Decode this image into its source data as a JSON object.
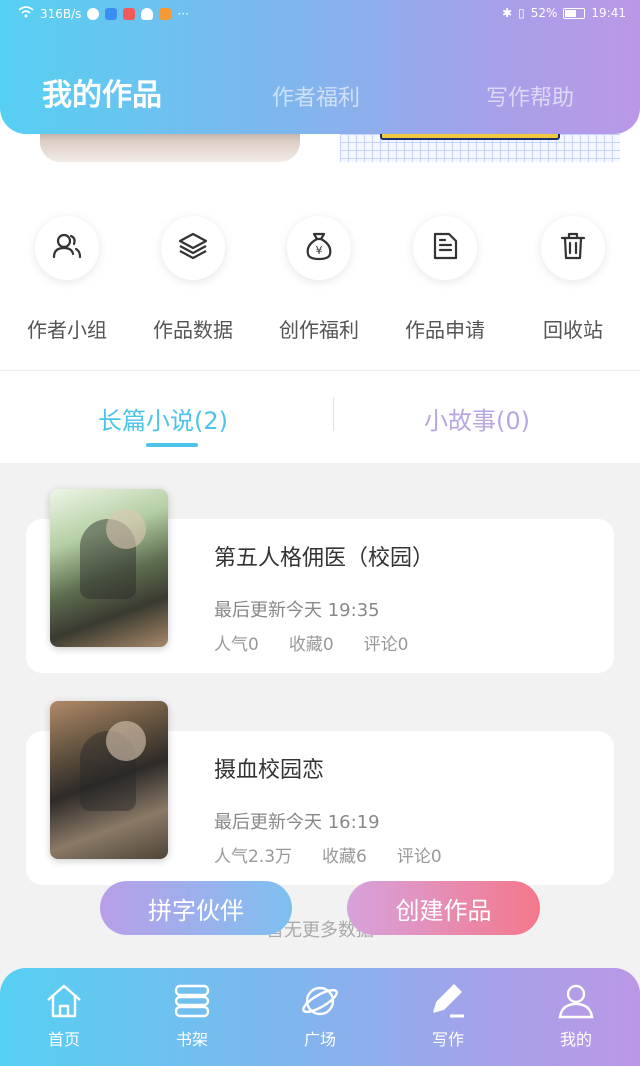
{
  "status_bar": {
    "network_speed": "316B/s",
    "battery": "52%",
    "time": "19:41",
    "more": "···"
  },
  "header": {
    "tabs": [
      "我的作品",
      "作者福利",
      "写作帮助"
    ]
  },
  "actions": [
    {
      "label": "作者小组",
      "icon": "group-icon"
    },
    {
      "label": "作品数据",
      "icon": "layers-icon"
    },
    {
      "label": "创作福利",
      "icon": "money-bag-icon"
    },
    {
      "label": "作品申请",
      "icon": "document-icon"
    },
    {
      "label": "回收站",
      "icon": "trash-icon"
    }
  ],
  "work_tabs": {
    "long": "长篇小说(2)",
    "short": "小故事(0)"
  },
  "works": [
    {
      "title": "第五人格佣医（校园）",
      "updated": "最后更新今天 19:35",
      "popularity": "人气0",
      "favorites": "收藏0",
      "comments": "评论0"
    },
    {
      "title": "摄血校园恋",
      "updated": "最后更新今天 16:19",
      "popularity": "人气2.3万",
      "favorites": "收藏6",
      "comments": "评论0"
    }
  ],
  "no_more": "暂无更多数据",
  "buttons": {
    "partner": "拼字伙伴",
    "create": "创建作品"
  },
  "bottom_nav": [
    {
      "label": "首页",
      "icon": "home-icon"
    },
    {
      "label": "书架",
      "icon": "bookshelf-icon"
    },
    {
      "label": "广场",
      "icon": "planet-icon"
    },
    {
      "label": "写作",
      "icon": "pen-icon"
    },
    {
      "label": "我的",
      "icon": "profile-icon"
    }
  ],
  "colors": {
    "accent_blue": "#4cc4e8",
    "accent_purple": "#b9a6e0",
    "create_button": "#f4788a"
  }
}
